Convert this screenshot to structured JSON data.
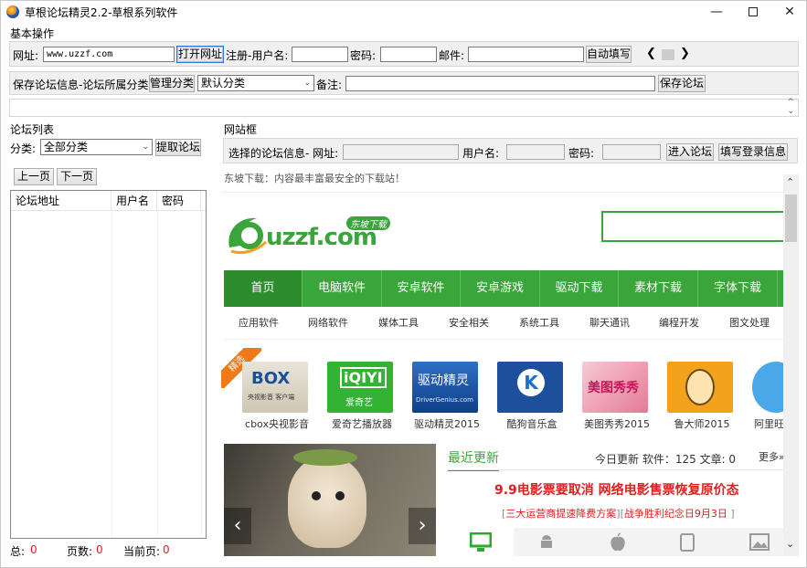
{
  "window": {
    "title": "草根论坛精灵2.2-草根系列软件"
  },
  "basic": {
    "section_label": "基本操作",
    "url_label": "网址:",
    "url_value": "www.uzzf.com",
    "open_button": "打开网址",
    "register_user_label": "注册-用户名:",
    "password_label": "密码:",
    "email_label": "邮件:",
    "autofill_button": "自动填写",
    "save_info_label": "保存论坛信息-论坛所属分类:",
    "manage_button": "管理分类",
    "category_value": "默认分类",
    "note_label": "备注:",
    "save_forum_button": "保存论坛"
  },
  "forum_list": {
    "section_label": "论坛列表",
    "category_label": "分类:",
    "category_value": "全部分类",
    "fetch_button": "提取论坛",
    "prev_button": "上一页",
    "next_button": "下一页",
    "columns": [
      "论坛地址",
      "用户名",
      "密码"
    ],
    "total_label": "总:",
    "total_value": "0",
    "pages_label": "页数:",
    "pages_value": "0",
    "current_label": "当前页:",
    "current_value": "0"
  },
  "site_frame": {
    "section_label": "网站框",
    "selected_label": "选择的论坛信息- 网址:",
    "user_label": "用户名:",
    "password_label": "密码:",
    "enter_button": "进入论坛",
    "fill_button": "填写登录信息"
  },
  "webpage": {
    "top_text": "东坡下载：内容最丰富最安全的下载站！",
    "logo_main": "uzzf.com",
    "logo_badge": "东坡下载",
    "nav": [
      "首页",
      "电脑软件",
      "安卓软件",
      "安卓游戏",
      "驱动下载",
      "素材下载",
      "字体下载"
    ],
    "subnav": [
      "应用软件",
      "网络软件",
      "媒体工具",
      "安全相关",
      "系统工具",
      "聊天通讯",
      "编程开发",
      "图文处理"
    ],
    "featured_badge": "精选",
    "apps": [
      {
        "name": "cbox央视影音",
        "icon_text": "BOX",
        "icon_sub": "央视影音 客户端"
      },
      {
        "name": "爱奇艺播放器",
        "icon_text": "iQIYI",
        "icon_sub": "爱奇艺"
      },
      {
        "name": "驱动精灵2015",
        "icon_text": "驱动精灵",
        "icon_sub": "DriverGenius.com"
      },
      {
        "name": "酷狗音乐盒",
        "icon_text": "K",
        "icon_sub": ""
      },
      {
        "name": "美图秀秀2015",
        "icon_text": "美图秀秀",
        "icon_sub": ""
      },
      {
        "name": "鲁大师2015",
        "icon_text": "",
        "icon_sub": ""
      },
      {
        "name": "阿里旺",
        "icon_text": "",
        "icon_sub": ""
      }
    ],
    "recent_title": "最近更新",
    "stats_text": "今日更新 软件：125 文章: 0",
    "more_text": "更多»",
    "headline": "9.9电影票要取消 网络电影售票恢复原价态",
    "link1": "三大运营商提速降费方案",
    "link2": "战争胜利纪念日9月3日",
    "colors": {
      "green": "#3aa53a",
      "red": "#e02020"
    }
  }
}
